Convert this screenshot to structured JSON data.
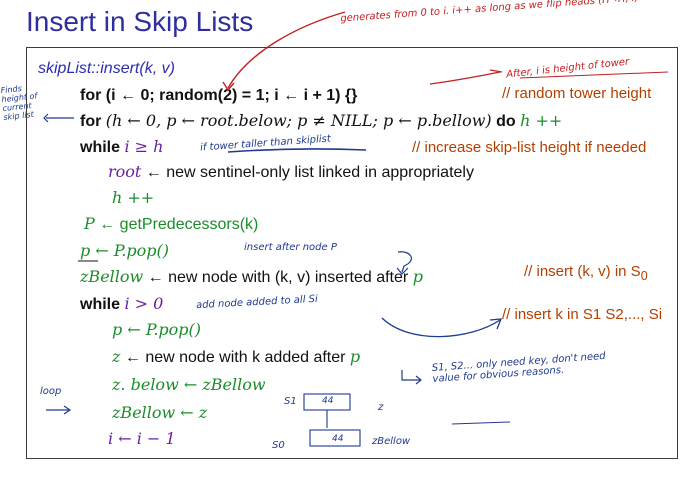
{
  "slide": {
    "title": "Insert in Skip Lists",
    "code": {
      "signature": "skipList::insert(k, v)",
      "line1": "for (i ← 0; random(2) = 1; i ← i + 1) {}",
      "line2_kw_for": "for",
      "line2_body": "(h ← 0, p ← root.below; p ≠ NILL; p ← p.bellow)",
      "line2_kw_do": "do",
      "line2_tail": "h ++",
      "line3_kw": "while",
      "line3_cond": "i ≥ h",
      "line4_var": "root",
      "line4_text": "← new sentinel-only list linked in appropriately",
      "line5": "h ++",
      "line6_var": "P",
      "line6_call": "← getPredecessors(k)",
      "line7": "p ← P.pop()",
      "line8_var": "zBellow",
      "line8_text": "← new node with (k, v) inserted after",
      "line8_p": "p",
      "line9_kw": "while",
      "line9_cond": "i > 0",
      "line10": "p ← P.pop()",
      "line11_var": "z",
      "line11_text": "← new node with k added after",
      "line11_p": "p",
      "line12": "z. below ← zBellow",
      "line13": "zBellow ← z",
      "line14": "i ← i − 1"
    },
    "comments": {
      "random_tower": "// random tower height",
      "increase_height": "// increase skip-list height if needed",
      "insert_s0_prefix": "// insert (k, v) in S",
      "insert_s0_sub": "0",
      "insert_all_prefix": "// insert k in S",
      "insert_all_rest": "1 S2,..., Si"
    },
    "annotations": {
      "top_right": "generates from 0 to i. i++ as long as we flip heads (H→H, I)",
      "after_i": "After, i is height of tower",
      "finds_height": "Finds height of current skip list",
      "tower_taller": "if tower taller than skiplist",
      "insert_after": "insert after node P",
      "add_node": "add node added to all Si",
      "s_levels": "S1, S2... only need key, don't need value for obvious reasons.",
      "loop": "loop",
      "s1_label": "S1",
      "s0_label": "S0",
      "node_key_top": "44",
      "node_key_bottom": "44",
      "z_label": "z",
      "zbellow_label": "zBellow"
    }
  }
}
